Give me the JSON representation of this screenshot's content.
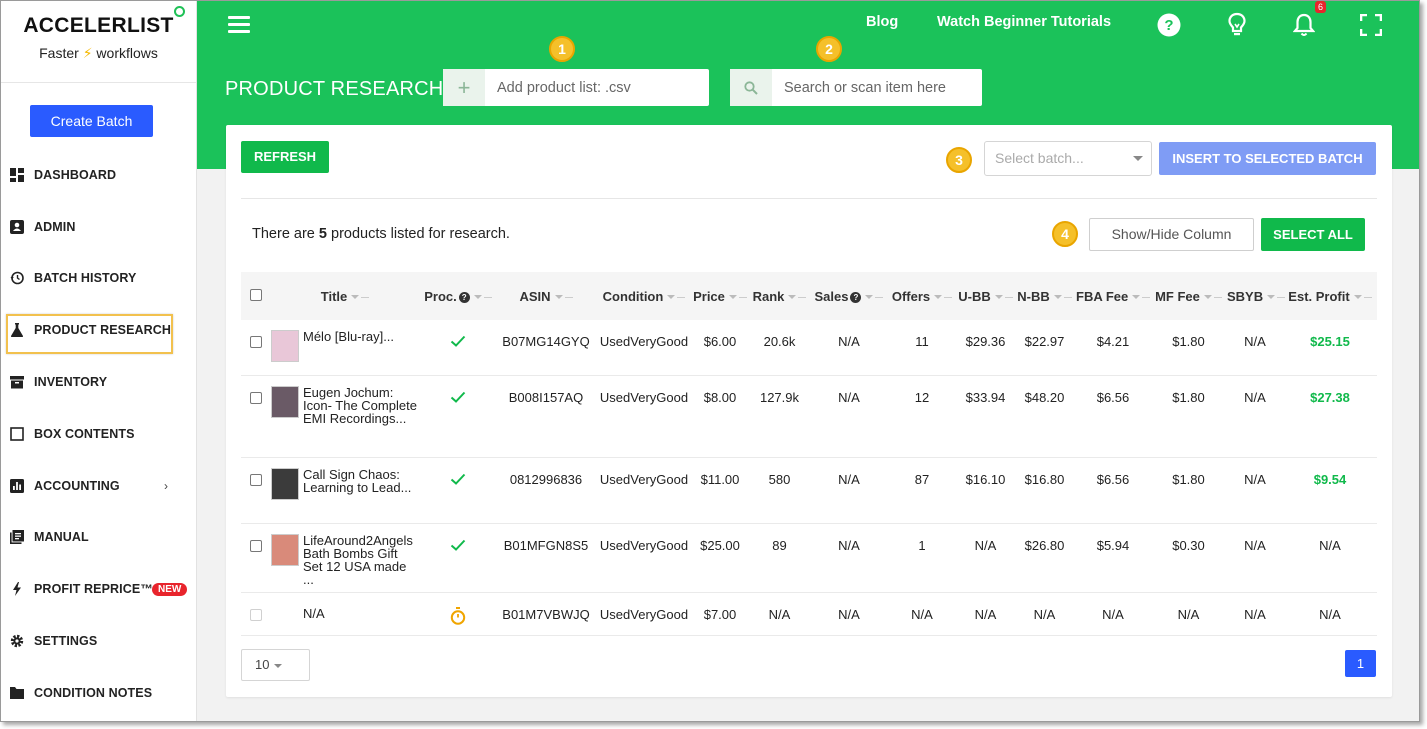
{
  "brand": {
    "name": "ACCELERLIST",
    "tagline_pre": "Faster ",
    "tagline_bolt": "⚡",
    "tagline_post": " workflows"
  },
  "sidebar": {
    "create_batch": "Create Batch",
    "items": [
      {
        "label": "DASHBOARD",
        "icon": "dashboard-icon"
      },
      {
        "label": "ADMIN",
        "icon": "admin-icon"
      },
      {
        "label": "BATCH HISTORY",
        "icon": "history-icon"
      },
      {
        "label": "PRODUCT RESEARCH",
        "icon": "flask-icon"
      },
      {
        "label": "INVENTORY",
        "icon": "inventory-icon"
      },
      {
        "label": "BOX CONTENTS",
        "icon": "box-icon"
      },
      {
        "label": "ACCOUNTING",
        "icon": "chart-icon"
      },
      {
        "label": "MANUAL",
        "icon": "manual-icon"
      },
      {
        "label": "PROFIT REPRICE™",
        "icon": "bolt-icon",
        "badge": "NEW"
      },
      {
        "label": "SETTINGS",
        "icon": "gear-icon"
      },
      {
        "label": "CONDITION NOTES",
        "icon": "notes-icon"
      }
    ]
  },
  "header": {
    "blog": "Blog",
    "tutorials": "Watch Beginner Tutorials",
    "notifications_count": "6",
    "page_title": "PRODUCT RESEARCH",
    "add_list_placeholder": "Add product list: .csv",
    "search_placeholder": "Search or scan item here",
    "steps": [
      "1",
      "2",
      "3",
      "4"
    ]
  },
  "toolbar": {
    "refresh": "REFRESH",
    "select_batch_placeholder": "Select batch...",
    "insert": "INSERT TO SELECTED BATCH",
    "summary_pre": "There are ",
    "summary_count": "5",
    "summary_post": " products listed for research.",
    "show_hide": "Show/Hide Column",
    "select_all": "SELECT ALL"
  },
  "table": {
    "columns": [
      "Title",
      "Proc.",
      "ASIN",
      "Condition",
      "Price",
      "Rank",
      "Sales",
      "Offers",
      "U-BB",
      "N-BB",
      "FBA Fee",
      "MF Fee",
      "SBYB",
      "Est. Profit"
    ],
    "rows": [
      {
        "title": "Mélo [Blu-ray]...",
        "status": "done",
        "asin": "B07MG14GYQ",
        "condition": "UsedVeryGood",
        "price": "$6.00",
        "rank": "20.6k",
        "sales": "N/A",
        "offers": "11",
        "ubb": "$29.36",
        "nbb": "$22.97",
        "fba": "$4.21",
        "mf": "$1.80",
        "sbyb": "N/A",
        "profit": "$25.15",
        "profit_positive": true,
        "thumb_color": "#e9c7d8"
      },
      {
        "title": "Eugen Jochum: Icon- The Complete EMI Recordings...",
        "status": "done",
        "asin": "B008I157AQ",
        "condition": "UsedVeryGood",
        "price": "$8.00",
        "rank": "127.9k",
        "sales": "N/A",
        "offers": "12",
        "ubb": "$33.94",
        "nbb": "$48.20",
        "fba": "$6.56",
        "mf": "$1.80",
        "sbyb": "N/A",
        "profit": "$27.38",
        "profit_positive": true,
        "thumb_color": "#6a5a66"
      },
      {
        "title": "Call Sign Chaos: Learning to Lead...",
        "status": "done",
        "asin": "0812996836",
        "condition": "UsedVeryGood",
        "price": "$11.00",
        "rank": "580",
        "sales": "N/A",
        "offers": "87",
        "ubb": "$16.10",
        "nbb": "$16.80",
        "fba": "$6.56",
        "mf": "$1.80",
        "sbyb": "N/A",
        "profit": "$9.54",
        "profit_positive": true,
        "thumb_color": "#3b3b3b"
      },
      {
        "title": "LifeAround2Angels Bath Bombs Gift Set 12 USA made ...",
        "status": "done",
        "asin": "B01MFGN8S5",
        "condition": "UsedVeryGood",
        "price": "$25.00",
        "rank": "89",
        "sales": "N/A",
        "offers": "1",
        "ubb": "N/A",
        "nbb": "$26.80",
        "fba": "$5.94",
        "mf": "$0.30",
        "sbyb": "N/A",
        "profit": "N/A",
        "profit_positive": false,
        "thumb_color": "#d98a7a"
      },
      {
        "title": "N/A",
        "status": "pending",
        "asin": "B01M7VBWJQ",
        "condition": "UsedVeryGood",
        "price": "$7.00",
        "rank": "N/A",
        "sales": "N/A",
        "offers": "N/A",
        "ubb": "N/A",
        "nbb": "N/A",
        "fba": "N/A",
        "mf": "N/A",
        "sbyb": "N/A",
        "profit": "N/A",
        "profit_positive": false,
        "thumb_color": ""
      }
    ]
  },
  "footer": {
    "per_page": "10",
    "page": "1"
  },
  "colors": {
    "brand_green": "#1bc25a",
    "button_green": "#10b94b",
    "primary_blue": "#2a5bff",
    "step_yellow": "#f5c02a"
  }
}
